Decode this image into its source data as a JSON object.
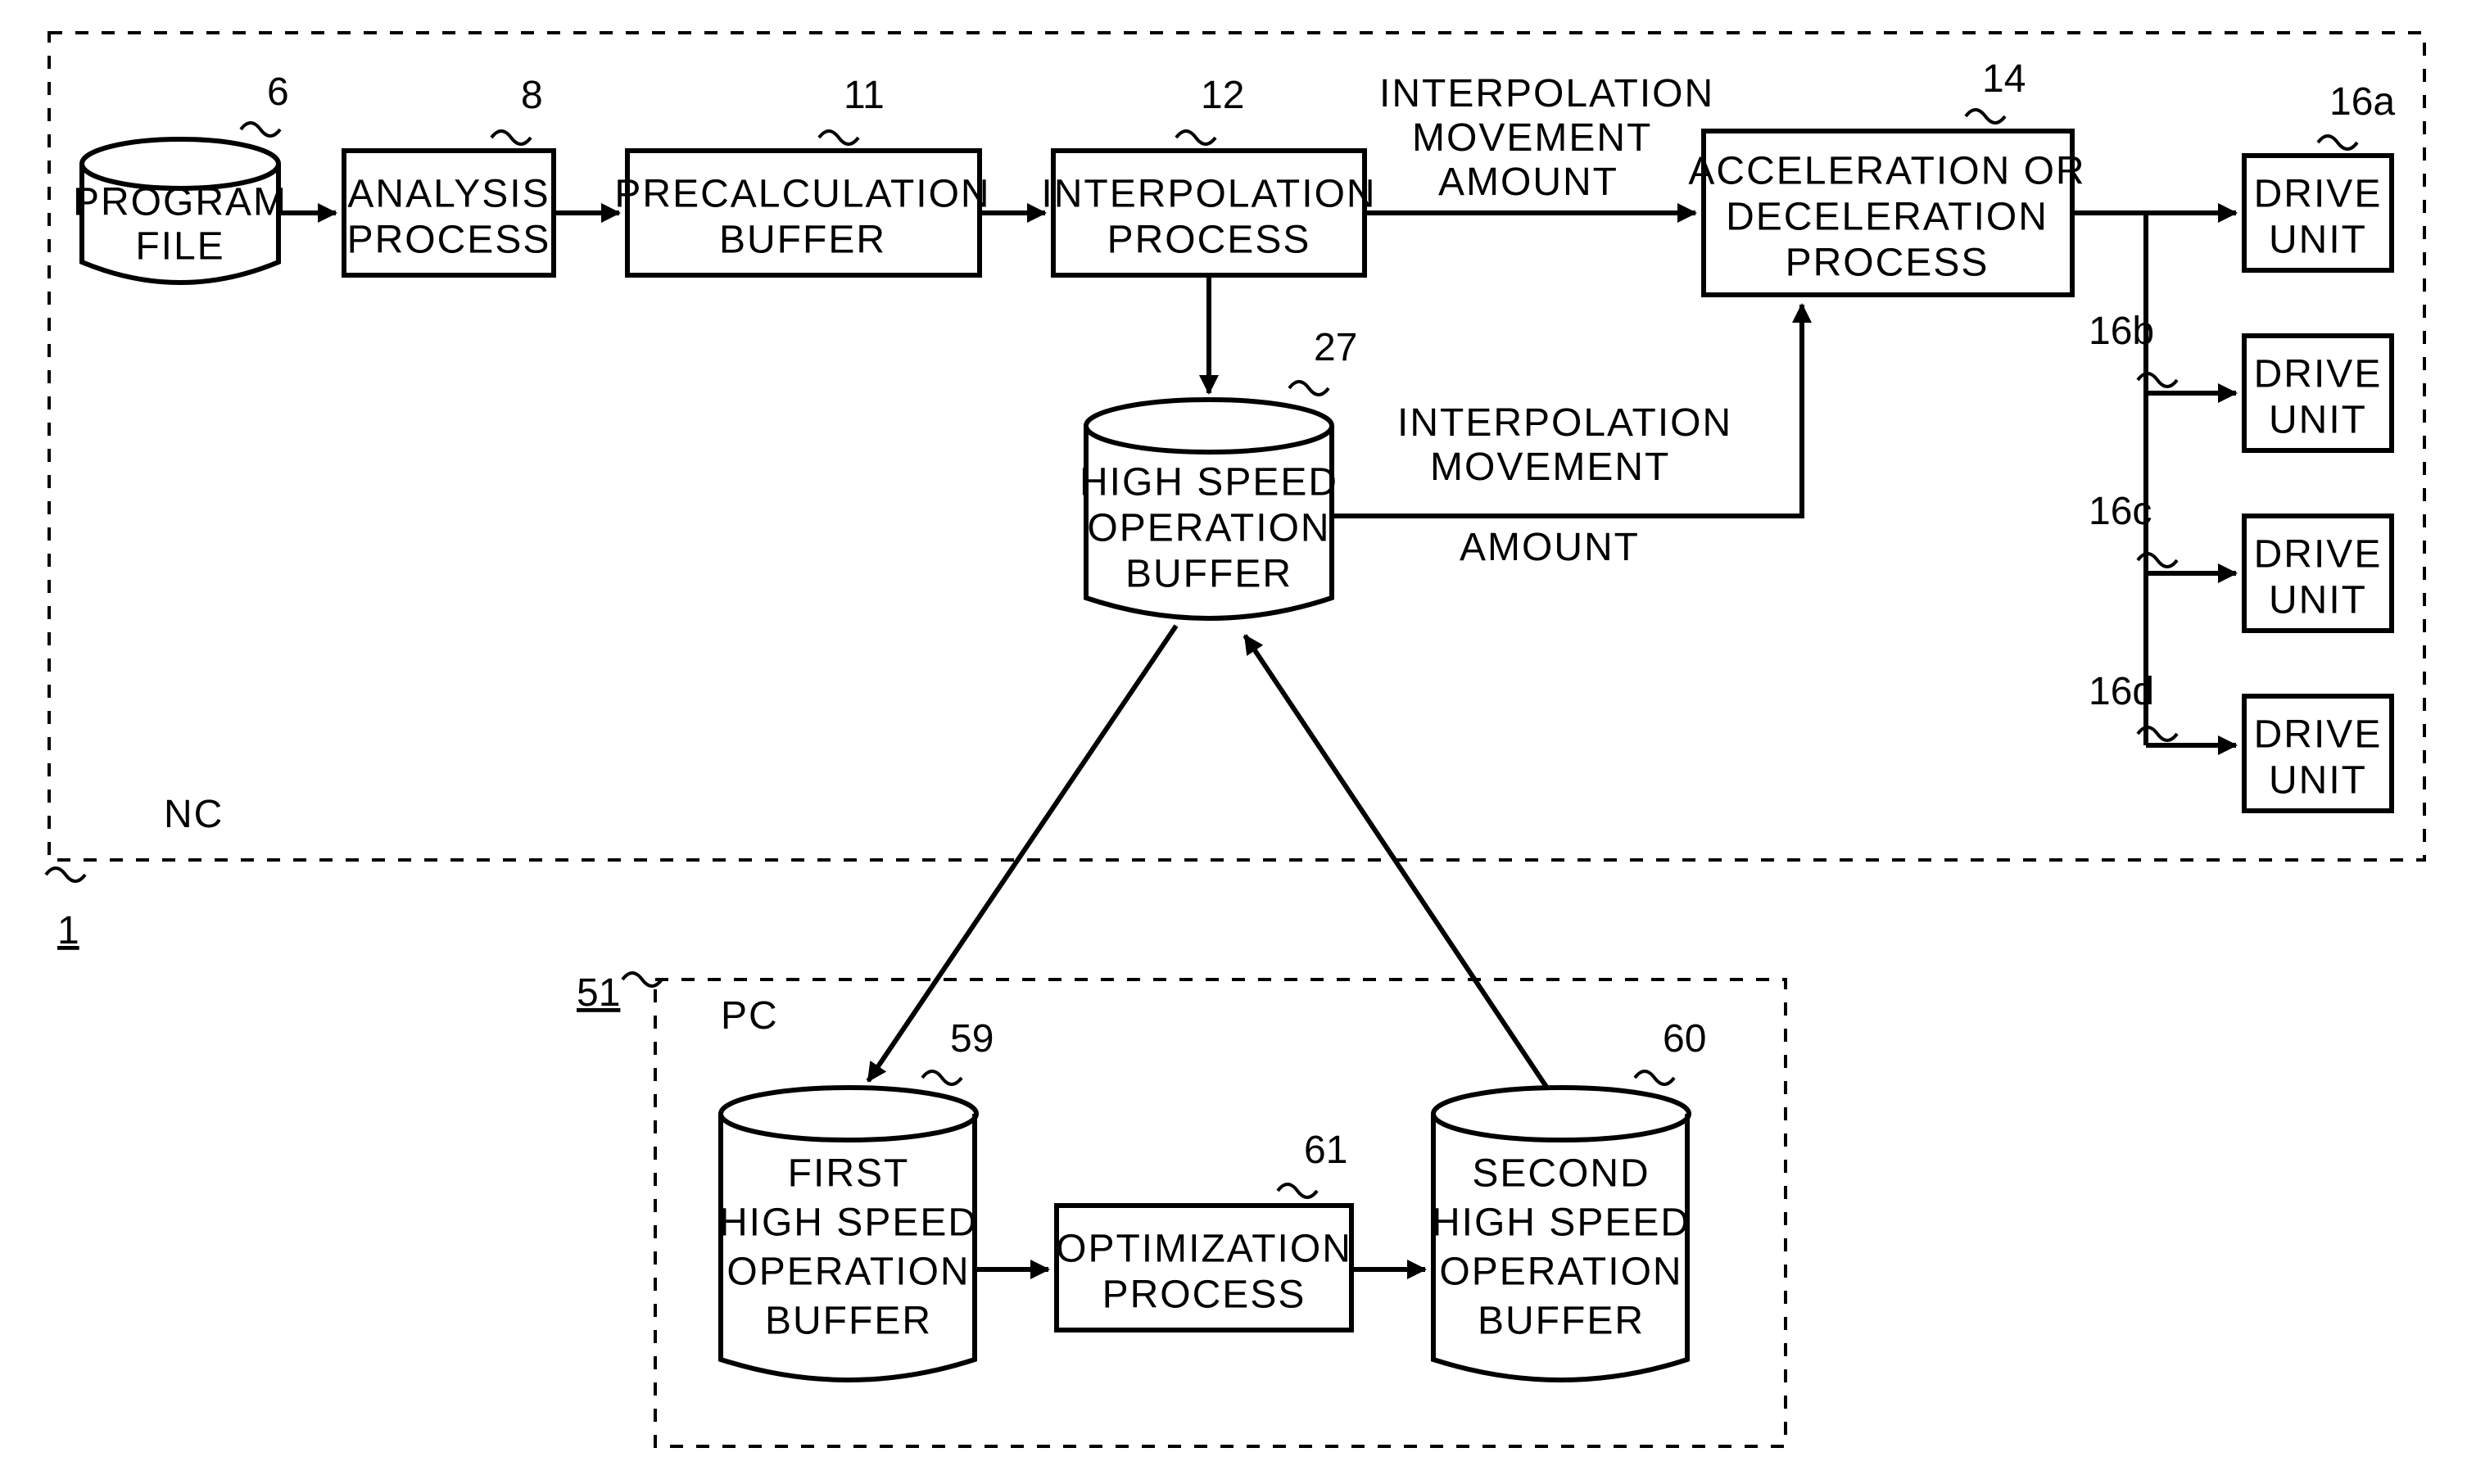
{
  "frames": {
    "nc_label": "NC",
    "nc_ref": "1",
    "pc_label": "PC",
    "pc_ref": "51"
  },
  "boxes": {
    "program_file": {
      "line1": "PROGRAM",
      "line2": "FILE",
      "ref": "6"
    },
    "analysis": {
      "line1": "ANALYSIS",
      "line2": "PROCESS",
      "ref": "8"
    },
    "precalc": {
      "line1": "PRECALCULATION",
      "line2": "BUFFER",
      "ref": "11"
    },
    "interp": {
      "line1": "INTERPOLATION",
      "line2": "PROCESS",
      "ref": "12"
    },
    "accel": {
      "line1": "ACCELERATION OR",
      "line2": "DECELERATION",
      "line3": "PROCESS",
      "ref": "14"
    },
    "hs_buffer": {
      "line1": "HIGH SPEED",
      "line2": "OPERATION",
      "line3": "BUFFER",
      "ref": "27"
    },
    "drive_a": {
      "line1": "DRIVE",
      "line2": "UNIT",
      "ref": "16a"
    },
    "drive_b": {
      "line1": "DRIVE",
      "line2": "UNIT",
      "ref": "16b"
    },
    "drive_c": {
      "line1": "DRIVE",
      "line2": "UNIT",
      "ref": "16c"
    },
    "drive_d": {
      "line1": "DRIVE",
      "line2": "UNIT",
      "ref": "16d"
    },
    "first_buf": {
      "line1": "FIRST",
      "line2": "HIGH SPEED",
      "line3": "OPERATION",
      "line4": "BUFFER",
      "ref": "59"
    },
    "opt": {
      "line1": "OPTIMIZATION",
      "line2": "PROCESS",
      "ref": "61"
    },
    "second_buf": {
      "line1": "SECOND",
      "line2": "HIGH SPEED",
      "line3": "OPERATION",
      "line4": "BUFFER",
      "ref": "60"
    }
  },
  "arrow_labels": {
    "ima_top": {
      "line1": "INTERPOLATION",
      "line2": "MOVEMENT",
      "line3": "AMOUNT"
    },
    "ima_side": {
      "line1": "INTERPOLATION",
      "line2": "MOVEMENT",
      "line3": "AMOUNT"
    }
  }
}
